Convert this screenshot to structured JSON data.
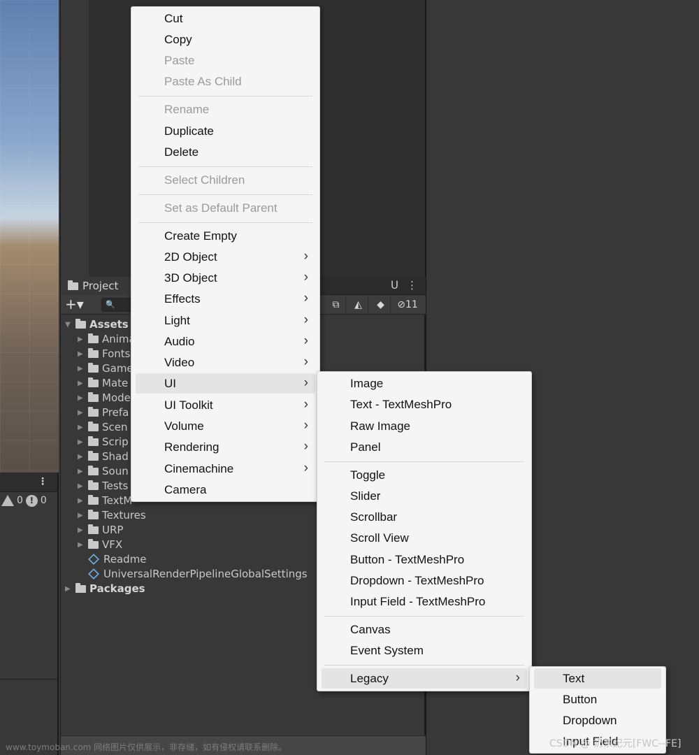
{
  "project_panel": {
    "tab_label": "Project",
    "hidden_count": "11",
    "search_icon_glyph": "🔍",
    "tree": {
      "assets": "Assets",
      "folders": [
        "Anima",
        "Fonts",
        "Game",
        "Mate",
        "Mode",
        "Prefa",
        "Scen",
        "Scrip",
        "Shad",
        "Soun",
        "Tests",
        "TextM",
        "Textures",
        "URP",
        "VFX"
      ],
      "files": [
        "Readme",
        "UniversalRenderPipelineGlobalSettings"
      ],
      "packages": "Packages"
    }
  },
  "console": {
    "warning_count": "0",
    "error_count": "0"
  },
  "context_menu": {
    "items": [
      {
        "label": "Cut",
        "disabled": false
      },
      {
        "label": "Copy",
        "disabled": false
      },
      {
        "label": "Paste",
        "disabled": true
      },
      {
        "label": "Paste As Child",
        "disabled": true
      },
      {
        "label": "Rename",
        "disabled": true
      },
      {
        "label": "Duplicate",
        "disabled": false
      },
      {
        "label": "Delete",
        "disabled": false
      },
      {
        "label": "Select Children",
        "disabled": true
      },
      {
        "label": "Set as Default Parent",
        "disabled": true
      },
      {
        "label": "Create Empty",
        "disabled": false
      },
      {
        "label": "2D Object",
        "submenu": true
      },
      {
        "label": "3D Object",
        "submenu": true
      },
      {
        "label": "Effects",
        "submenu": true
      },
      {
        "label": "Light",
        "submenu": true
      },
      {
        "label": "Audio",
        "submenu": true
      },
      {
        "label": "Video",
        "submenu": true
      },
      {
        "label": "UI",
        "submenu": true,
        "highlighted": true
      },
      {
        "label": "UI Toolkit",
        "submenu": true
      },
      {
        "label": "Volume",
        "submenu": true
      },
      {
        "label": "Rendering",
        "submenu": true
      },
      {
        "label": "Cinemachine",
        "submenu": true
      },
      {
        "label": "Camera",
        "disabled": false
      }
    ]
  },
  "ui_submenu": {
    "items": [
      {
        "label": "Image"
      },
      {
        "label": "Text - TextMeshPro"
      },
      {
        "label": "Raw Image"
      },
      {
        "label": "Panel"
      },
      {
        "label": "Toggle"
      },
      {
        "label": "Slider"
      },
      {
        "label": "Scrollbar"
      },
      {
        "label": "Scroll View"
      },
      {
        "label": "Button - TextMeshPro"
      },
      {
        "label": "Dropdown - TextMeshPro"
      },
      {
        "label": "Input Field - TextMeshPro"
      },
      {
        "label": "Canvas"
      },
      {
        "label": "Event System"
      },
      {
        "label": "Legacy",
        "submenu": true,
        "highlighted": true
      }
    ]
  },
  "legacy_submenu": {
    "items": [
      {
        "label": "Text",
        "highlighted": true
      },
      {
        "label": "Button"
      },
      {
        "label": "Dropdown"
      },
      {
        "label": "Input Field"
      }
    ]
  },
  "watermarks": {
    "left": "www.toymoban.com 网络图片仅供展示，非存储，如有侵权请联系删除。",
    "right": "CSDN @ 奶茶纪元[FWC--FE]"
  },
  "colors": {
    "editor_bg": "#383838",
    "menu_bg": "#f5f5f5",
    "menu_highlight": "#e4e4e4",
    "disabled_text": "#9a9a9a"
  }
}
